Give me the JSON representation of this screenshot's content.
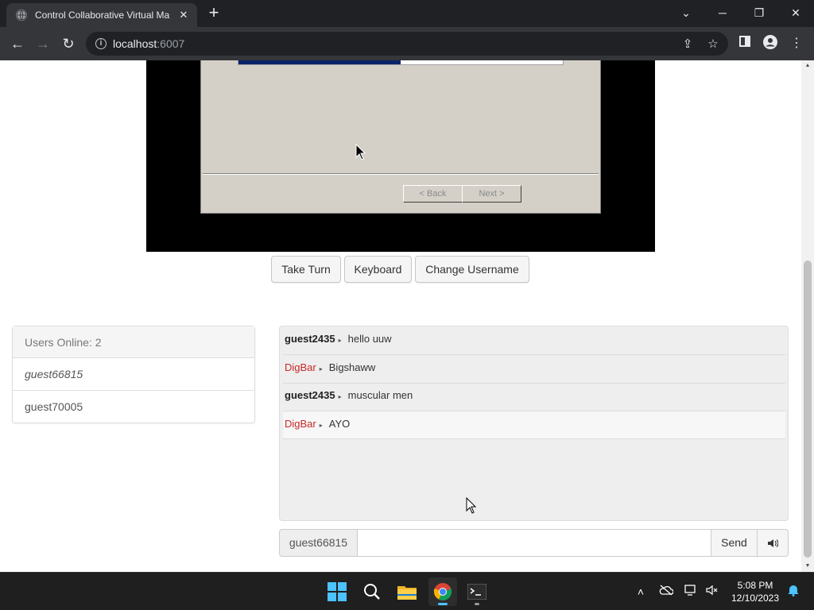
{
  "browser": {
    "tab_title": "Control Collaborative Virtual Ma",
    "url_host": "localhost",
    "url_port": ":6007"
  },
  "vm": {
    "progress_fraction": 0.5,
    "back_label": "< Back",
    "next_label": "Next >"
  },
  "controls": {
    "take_turn": "Take Turn",
    "keyboard": "Keyboard",
    "change_username": "Change Username"
  },
  "users": {
    "header": "Users Online: 2",
    "list": [
      "guest66815",
      "guest70005"
    ]
  },
  "chat": {
    "messages": [
      {
        "user": "guest2435",
        "text": "hello uuw"
      },
      {
        "user": "DigBar",
        "text": "Bigshaww"
      },
      {
        "user": "guest2435",
        "text": "muscular men"
      },
      {
        "user": "DigBar",
        "text": "AYO"
      }
    ],
    "username": "guest66815",
    "input_value": "",
    "send_label": "Send"
  },
  "taskbar": {
    "time": "5:08 PM",
    "date": "12/10/2023"
  },
  "colors": {
    "chrome_dark": "#202124",
    "chrome_toolbar": "#35363a",
    "wizard_gray": "#d4d0c8",
    "wizard_progress": "#0a246a",
    "chat_red_user": "#c62828",
    "taskbar": "#1f1f1f"
  }
}
